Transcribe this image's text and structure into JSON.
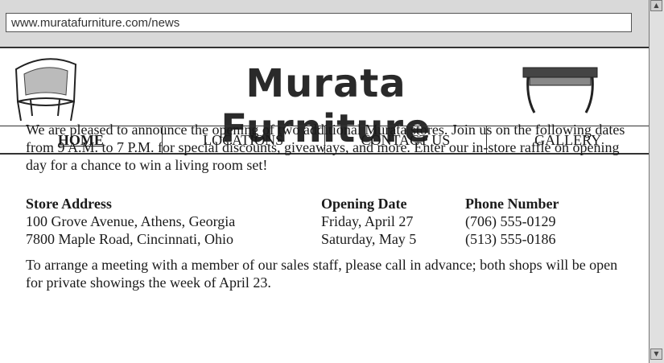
{
  "browser": {
    "url": "www.muratafurniture.com/news"
  },
  "site": {
    "brand": "Murata Furniture"
  },
  "nav": {
    "items": [
      {
        "label": "HOME"
      },
      {
        "label": "LOCATIONS"
      },
      {
        "label": "CONTACT US"
      },
      {
        "label": "GALLERY"
      }
    ]
  },
  "content": {
    "intro": "We are pleased to announce the opening of two additional Murata stores. Join us on the following dates from 9 A.M. to 7 P.M. for special discounts, giveaways, and more. Enter our in-store raffle on opening day for a chance to win a living room set!",
    "headers": {
      "address": "Store Address",
      "date": "Opening Date",
      "phone": "Phone Number"
    },
    "stores": [
      {
        "address": "100 Grove Avenue, Athens, Georgia",
        "date": "Friday, April 27",
        "phone": "(706) 555-0129"
      },
      {
        "address": "7800 Maple Road, Cincinnati, Ohio",
        "date": "Saturday, May 5",
        "phone": "(513) 555-0186"
      }
    ],
    "closing": "To arrange a meeting with a member of our sales staff, please call in advance; both shops will be open for private showings the week of April 23."
  },
  "icons": {
    "scroll_up": "scroll-up-arrow-icon",
    "scroll_down": "scroll-down-arrow-icon"
  }
}
